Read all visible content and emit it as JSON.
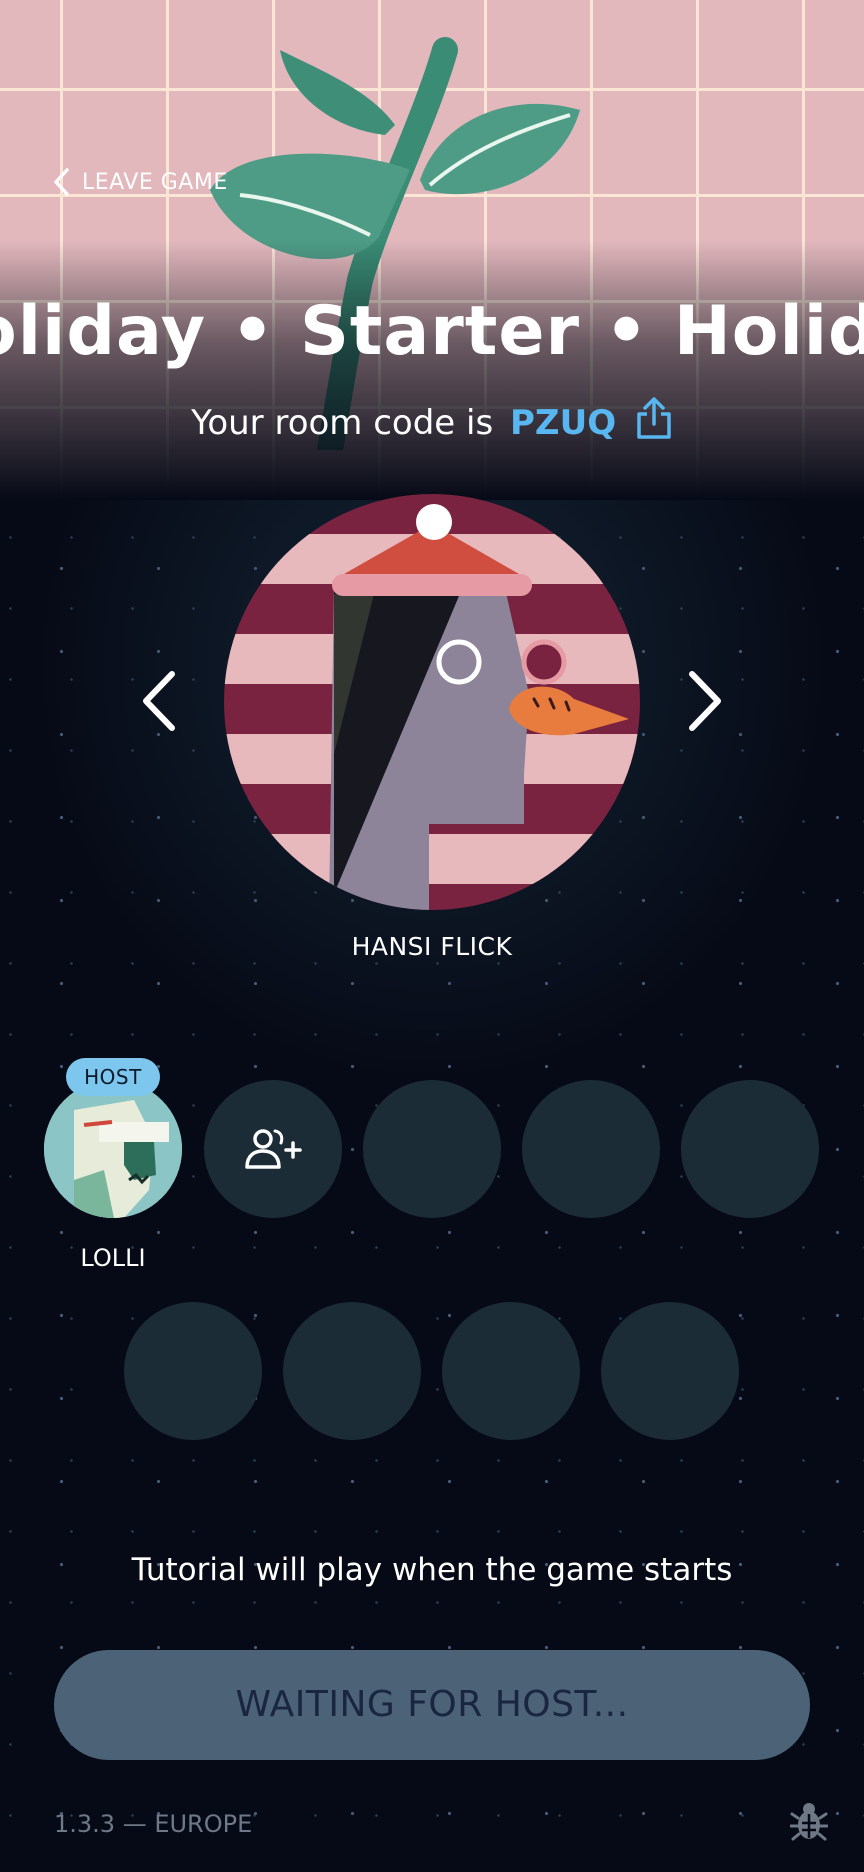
{
  "header": {
    "leave_label": "LEAVE GAME",
    "marquee": "oliday  •  Starter  •  Holid",
    "room_prefix": "Your room code is",
    "room_code": "PZUQ"
  },
  "avatar": {
    "name": "HANSI FLICK"
  },
  "players": {
    "host_badge": "HOST",
    "host_name": "LOLLI"
  },
  "footer": {
    "tutorial": "Tutorial will play when the game starts",
    "waiting": "WAITING FOR HOST...",
    "version": "1.3.3 — EUROPE"
  },
  "icons": {
    "back": "chevron-left-icon",
    "share": "share-icon",
    "prev": "chevron-left-icon",
    "next": "chevron-right-icon",
    "invite": "add-user-icon",
    "bug": "bug-icon"
  },
  "colors": {
    "accent": "#58b6f0",
    "background": "#060a16",
    "header_pink": "#e2b8bd",
    "host_badge": "#7dc6ee",
    "button": "#4b6277"
  }
}
